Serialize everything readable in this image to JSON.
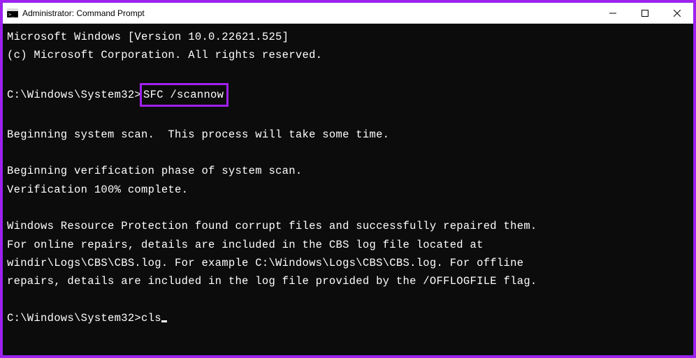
{
  "titlebar": {
    "title": "Administrator: Command Prompt"
  },
  "terminal": {
    "line_version": "Microsoft Windows [Version 10.0.22621.525]",
    "line_copyright": "(c) Microsoft Corporation. All rights reserved.",
    "prompt1_path": "C:\\Windows\\System32>",
    "prompt1_cmd": "SFC /scannow",
    "line_begin_scan": "Beginning system scan.  This process will take some time.",
    "line_begin_verify": "Beginning verification phase of system scan.",
    "line_verify_complete": "Verification 100% complete.",
    "line_result": "Windows Resource Protection found corrupt files and successfully repaired them.\nFor online repairs, details are included in the CBS log file located at\nwindir\\Logs\\CBS\\CBS.log. For example C:\\Windows\\Logs\\CBS\\CBS.log. For offline\nrepairs, details are included in the log file provided by the /OFFLOGFILE flag.",
    "prompt2_path": "C:\\Windows\\System32>",
    "prompt2_cmd": "cls"
  }
}
